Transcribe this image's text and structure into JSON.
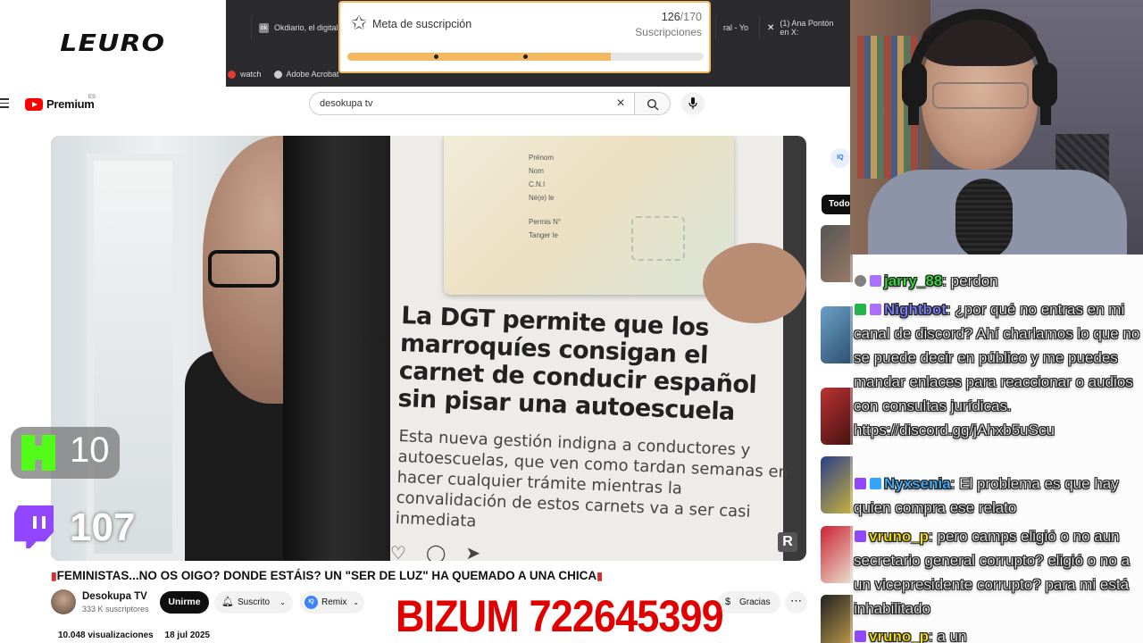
{
  "overlay": {
    "logo": "LEURO",
    "goal": {
      "title": "Meta de suscripción",
      "current": "126",
      "max": "/170",
      "unit": "Suscripciones",
      "progress": 0.74
    },
    "kick_count": "10",
    "twitch_count": "107",
    "bizum": "BIZUM 722645399"
  },
  "browser": {
    "tabs": [
      {
        "label": "Okdiario, el digital",
        "icon": "page-icon"
      },
      {
        "label": "(1) Ana Pontón en X:",
        "icon": "x-icon"
      }
    ],
    "tab_fragment": "ral - Yo",
    "bookmarks": [
      {
        "label": "watch",
        "color": "#e53935"
      },
      {
        "label": "Adobe Acrobat",
        "color": "#cccccc"
      }
    ]
  },
  "youtube": {
    "brand": "Premium",
    "region": "ES",
    "search_value": "desokupa tv",
    "video": {
      "headline": "La DGT permite que los marroquíes consigan el carnet de conducir español sin pisar una autoescuela",
      "subtext": "Esta nueva gestión indigna a conductores y autoescuelas, que ven como tardan semanas en hacer cualquier trámite mientras la convalidación de estos carnets va a ser casi inmediata",
      "id_fields": [
        "Prénom",
        "Nom",
        "C.N.I",
        "Né(e) le",
        "Permis N°",
        "Tanger le"
      ],
      "watermark": "R"
    },
    "title": "FEMINISTAS...NO OS OIGO? DONDE ESTÁIS? UN \"SER DE LUZ\" HA QUEMADO A UNA CHICA",
    "channel": {
      "name": "Desokupa TV",
      "subs": "333 K suscriptores",
      "join": "Unirme",
      "subscribed": "Suscrito",
      "remix": "Remix",
      "thanks": "Gracias"
    },
    "views": "10.048 visualizaciones",
    "date": "18 jul 2025",
    "sidebar": {
      "filter_all": "Todos"
    }
  },
  "chat": [
    {
      "user": "jarry_88",
      "text": ": perdon",
      "user_color": "#36e23a",
      "badges": [
        "gray",
        "sub"
      ]
    },
    {
      "user": "Nightbot",
      "text": ": ¿por qué no entras en mi canal de discord? Ahí charlamos lo que no se puede decir en público y me puedes mandar enlaces para reaccionar o audios con consultas jurídicas. https://discord.gg/jAhxb5uScu",
      "user_color": "#7c7cff",
      "badges": [
        "check",
        "sub"
      ]
    },
    {
      "user": "Nyxsenia",
      "text": ": El problema es que hay quien compra ese relato",
      "user_color": "#3fb0ff",
      "badges": [
        "prime",
        "mod"
      ]
    },
    {
      "user": "vruno_p",
      "text": ": pero camps eligió o no aun secretario general corrupto? eligió o no a un vicepresidente corrupto? para mi está inhabilitado",
      "user_color": "#f7e200",
      "badges": [
        "prime"
      ]
    },
    {
      "user": "vruno_p",
      "text": ": a un",
      "user_color": "#f7e200",
      "badges": [
        "prime"
      ]
    }
  ]
}
